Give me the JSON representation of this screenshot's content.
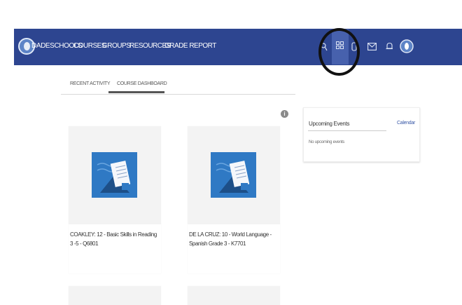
{
  "nav": {
    "brand": "DADESCHOOLS",
    "items": [
      {
        "label": "COURSES"
      },
      {
        "label": "GROUPS"
      },
      {
        "label": "RESOURCES"
      },
      {
        "label": "GRADE REPORT"
      }
    ],
    "icons": [
      "search-icon",
      "grid-icon",
      "backpack-icon",
      "mail-icon",
      "bell-icon",
      "avatar"
    ]
  },
  "tabs": [
    {
      "label": "RECENT ACTIVITY",
      "active": false
    },
    {
      "label": "COURSE DASHBOARD",
      "active": true
    }
  ],
  "courses": [
    {
      "title": "COAKLEY: 12 - Basic Skills in Reading 3 -5 - Q6801"
    },
    {
      "title": "DE LA CRUZ: 10 - World Language - Spanish Grade 3 - K7701"
    }
  ],
  "events": {
    "title": "Upcoming Events",
    "link": "Calendar",
    "empty": "No upcoming events"
  },
  "colors": {
    "topbar": "#2d4590",
    "tile_blue": "#2f79c4",
    "highlight": "#111111"
  }
}
